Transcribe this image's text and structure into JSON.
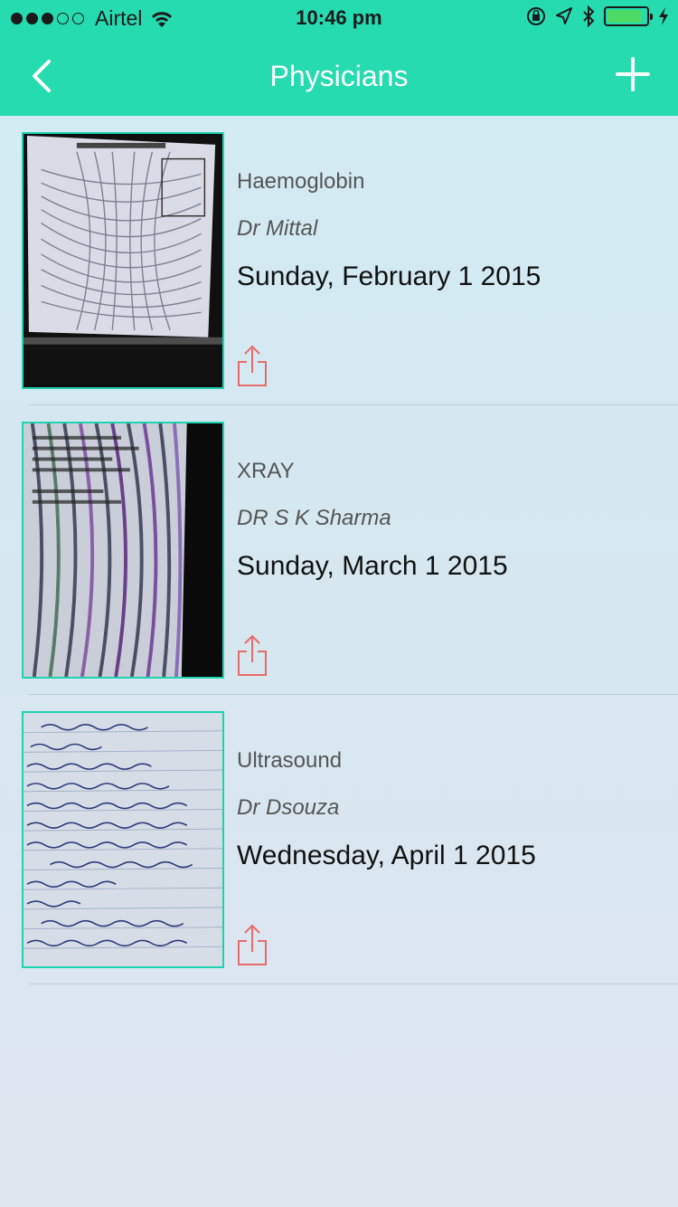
{
  "status_bar": {
    "carrier": "Airtel",
    "time": "10:46 pm",
    "signal_bars_filled": 3,
    "signal_bars_total": 5,
    "battery_level": 0.9
  },
  "nav": {
    "title": "Physicians",
    "back_icon": "chevron-left-icon",
    "add_icon": "plus-icon"
  },
  "colors": {
    "accent": "#26dbb0",
    "thumb_border": "#1fd3b0",
    "share_icon": "#e86b6b"
  },
  "records": [
    {
      "title": "Haemoglobin",
      "doctor": "Dr Mittal",
      "date": "Sunday, February 1 2015",
      "thumb": "xray-form-photo"
    },
    {
      "title": "XRAY",
      "doctor": "DR S K Sharma",
      "date": "Sunday, March 1 2015",
      "thumb": "screen-document-photo"
    },
    {
      "title": "Ultrasound",
      "doctor": "Dr Dsouza",
      "date": "Wednesday, April 1 2015",
      "thumb": "handwritten-notes-photo"
    }
  ]
}
